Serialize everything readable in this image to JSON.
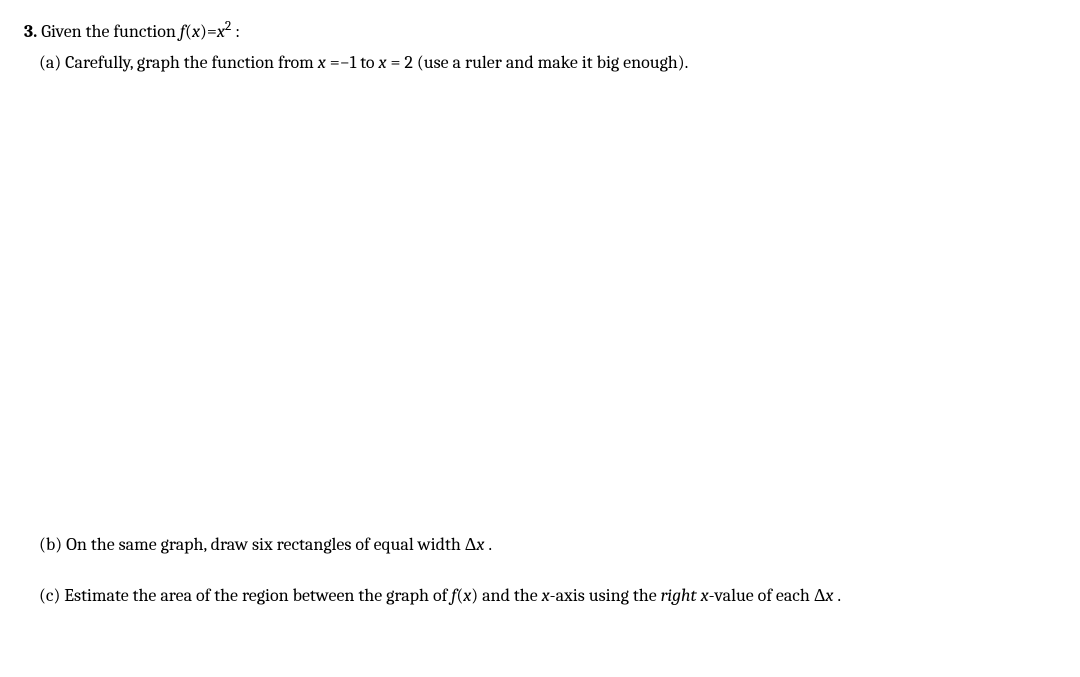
{
  "problem": {
    "number": "3.",
    "intro_prefix": "Given the function ",
    "function_lhs_f": "f",
    "function_lhs_open": "(",
    "function_lhs_x": "x",
    "function_lhs_close": ")",
    "function_eq": "=",
    "function_rhs_x": "x",
    "function_rhs_exp": "2",
    "intro_suffix": " :",
    "parts": {
      "a": {
        "label": "(a)",
        "text_before_x1": " Carefully, graph the function from ",
        "x1_var": "x",
        "x1_eq": " =",
        "x1_val": "−1",
        "mid_text": " to ",
        "x2_var": "x",
        "x2_eq": " =",
        "x2_val": " 2",
        "text_after": " (use a ruler and make it big enough)."
      },
      "b": {
        "label": "(b)",
        "text_before_dx": " On the same graph, draw six rectangles of equal width ",
        "delta": "Δ",
        "delta_x": "x",
        "period": " ."
      },
      "c": {
        "label": "(c)",
        "text_before_fx": " Estimate the area of the region between the graph of ",
        "fx_f": "f",
        "fx_open": "(",
        "fx_x": "x",
        "fx_close": ")",
        "text_mid1": " and the ",
        "x_axis_x": "x",
        "x_axis_text": "-axis using the ",
        "right_word": "right ",
        "x_value_x": "x",
        "text_mid2": "-value of each ",
        "delta": "Δ",
        "delta_x": "x",
        "period": " ."
      }
    }
  }
}
